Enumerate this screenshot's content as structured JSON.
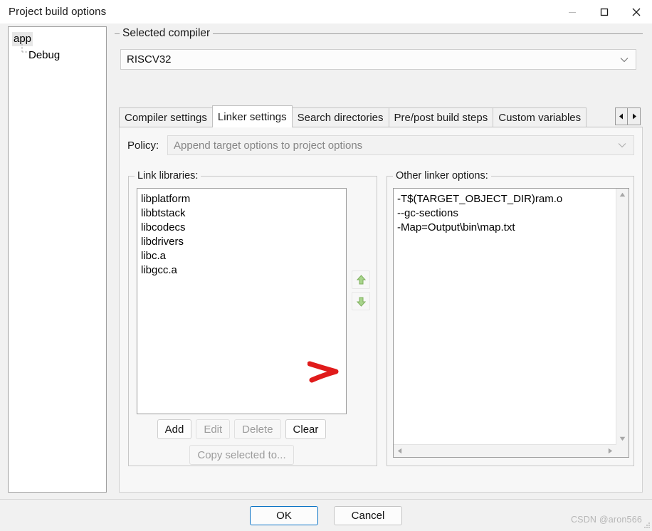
{
  "window": {
    "title": "Project build options",
    "controls": {
      "minimize": "minimize-button",
      "maximize": "maximize-button",
      "close": "close-button"
    }
  },
  "tree": {
    "root": "app",
    "child": "Debug"
  },
  "compiler_group": {
    "legend": "Selected compiler",
    "selected": "RISCV32"
  },
  "tabs": [
    {
      "label": "Compiler settings",
      "active": false
    },
    {
      "label": "Linker settings",
      "active": true
    },
    {
      "label": "Search directories",
      "active": false
    },
    {
      "label": "Pre/post build steps",
      "active": false
    },
    {
      "label": "Custom variables",
      "active": false
    }
  ],
  "tab_nav": {
    "prev": "◀",
    "next": "▶"
  },
  "policy": {
    "label": "Policy:",
    "value": "Append target options to project options"
  },
  "link_libraries": {
    "legend": "Link libraries:",
    "items": [
      "libplatform",
      "libbtstack",
      "libcodecs",
      "libdrivers",
      "libc.a",
      "libgcc.a"
    ],
    "move_up": "move-up-button",
    "move_down": "move-down-button",
    "buttons": [
      {
        "label": "Add",
        "enabled": true
      },
      {
        "label": "Edit",
        "enabled": false
      },
      {
        "label": "Delete",
        "enabled": false
      },
      {
        "label": "Clear",
        "enabled": true
      }
    ],
    "copy_selected": {
      "label": "Copy selected to...",
      "enabled": false
    }
  },
  "other_linker_options": {
    "legend": "Other linker options:",
    "lines": [
      "-T$(TARGET_OBJECT_DIR)ram.o",
      "--gc-sections",
      "-Map=Output\\bin\\map.txt"
    ]
  },
  "footer": {
    "ok": "OK",
    "cancel": "Cancel",
    "watermark": "CSDN @aron566"
  },
  "colors": {
    "accent_focus": "#0a72c4",
    "annotation": "#e01b1b",
    "dialog_bg": "#f1f1f1",
    "page_bg": "#f7f7f7",
    "field_bg": "#ffffff"
  }
}
